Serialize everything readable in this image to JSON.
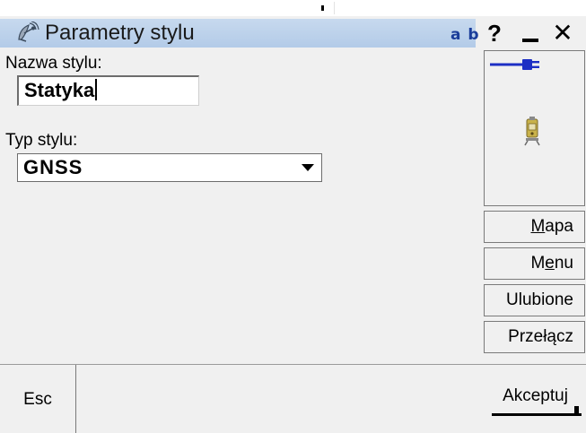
{
  "window": {
    "title": "Parametry stylu",
    "input_mode": "a b",
    "help_label": "?",
    "close_label": "✕"
  },
  "form": {
    "name_label": "Nazwa stylu:",
    "name_value": "Statyka",
    "type_label": "Typ stylu:",
    "type_value": "GNSS"
  },
  "side_buttons": {
    "map": {
      "pre": "",
      "ul": "M",
      "post": "apa"
    },
    "menu": {
      "pre": "M",
      "ul": "e",
      "post": "nu"
    },
    "favorites": {
      "pre": "",
      "ul": "",
      "post": "Ulubione"
    },
    "switch": {
      "pre": "",
      "ul": "",
      "post": "Przełącz"
    }
  },
  "bottom": {
    "esc_label": "Esc",
    "accept_label": "Akceptuj"
  },
  "icons": {
    "app": "satellite-dish-icon",
    "power": "plug-connector-icon",
    "instrument": "total-station-icon"
  },
  "colors": {
    "titlebar": "#b3cbe8",
    "input_mode": "#1b3d9a",
    "power_icon": "#1d2fc4",
    "instrument_icon": "#c9b24a"
  }
}
